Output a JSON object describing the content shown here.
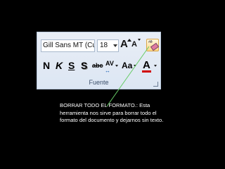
{
  "ribbon": {
    "font_name": "Gill Sans MT (Cue",
    "font_size": "18",
    "grow_label": "A",
    "shrink_label": "A",
    "clear_format_glyph": "ᴬᴮ",
    "bold_label": "N",
    "italic_label": "K",
    "underline_label": "S",
    "shadow_label": "S",
    "strike_label": "abc",
    "spacing_label": "AV",
    "spacing_arrow": "↔",
    "case_label": "Aa",
    "font_color_label": "A",
    "font_color": "#d00000",
    "group_label": "Fuente"
  },
  "caption": {
    "text": "BORRAR TODO EL FORMATO.: Esta herramienta nos sirve para borrar todo el formato del documento y dejarnos sin texto."
  },
  "colors": {
    "background": "#000000",
    "pointer_line": "#66cc66",
    "highlight": "#ffd98a"
  }
}
